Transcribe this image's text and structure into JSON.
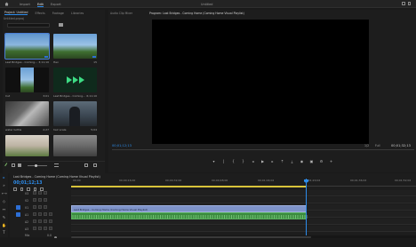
{
  "menu": {
    "import": "Import",
    "edit": "Edit",
    "export": "Export"
  },
  "app_title": "Untitled",
  "project_panel": {
    "tabs": [
      "Project: Untitled",
      "Effects",
      "Footage",
      "Libraries"
    ],
    "subtitle": "Untitled.prproj",
    "search_placeholder": "",
    "items": [
      {
        "name": "Last Bridges - Coming...",
        "duration": "3;11;10",
        "thumb": "palms-sky",
        "selected": true
      },
      {
        "name": "Hex",
        "duration": "15",
        "thumb": "palms-sky",
        "selected": false
      },
      {
        "name": "Cut",
        "duration": "3;01",
        "thumb": "palm-portrait",
        "selected": false
      },
      {
        "name": "Last Bridges - Coming...",
        "duration": "6;11;10",
        "thumb": "waveform-green",
        "selected": false
      },
      {
        "name": "water bottle",
        "duration": "2;27",
        "thumb": "indoor",
        "selected": false
      },
      {
        "name": "hair scale",
        "duration": "5;04",
        "thumb": "person",
        "selected": false
      },
      {
        "name": "",
        "duration": "",
        "thumb": "house",
        "selected": false
      },
      {
        "name": "",
        "duration": "",
        "thumb": "street",
        "selected": false
      }
    ]
  },
  "source_tab": "Audio Clip Mixer",
  "program_tab": "Program: Last Bridges - Coming Home (Coming Home Visual Playlist)",
  "program": {
    "timecode_left": "00;01;12;13",
    "timecode_right": "00;01;32;13",
    "fit": "1/2",
    "full": "Full"
  },
  "timeline": {
    "tab": "Last Bridges - Coming Home (Coming Home Visual Playlist)",
    "timecode": "00;01;12;13",
    "ruler": [
      "00;00",
      "00;00;16;00",
      "00;00;32;00",
      "00;00;48;00",
      "00;01;04;02",
      "00;01;20;02",
      "00;01;36;02",
      "00;01;52;02"
    ],
    "tracks": [
      "V3",
      "V2",
      "V1",
      "A1",
      "A2",
      "A3",
      "Mix"
    ],
    "video_clip": "Last Bridges - Coming Home (Coming Home Visual Playlist)",
    "mix_value": "0.0"
  },
  "colors": {
    "accent": "#2d8ceb",
    "video_clip": "#7e93c9",
    "audio_clip": "#3b8b3f",
    "work_area": "#d8c33a"
  }
}
